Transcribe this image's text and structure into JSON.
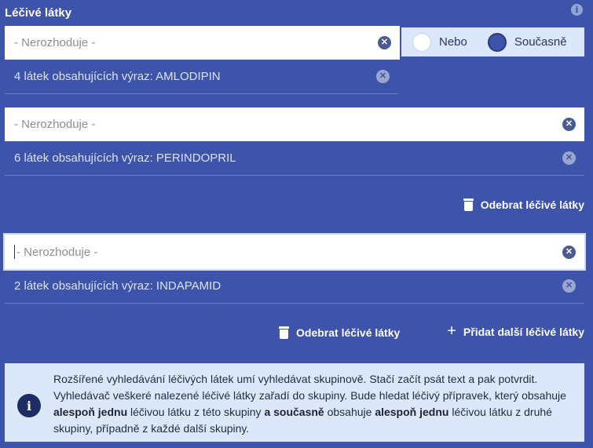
{
  "heading": "Léčivé látky",
  "groups": [
    {
      "placeholder": "- Nerozhoduje -",
      "result": "4 látek obsahujících výraz: AMLODIPIN"
    },
    {
      "placeholder": "- Nerozhoduje -",
      "result": "6 látek obsahujících výraz: PERINDOPRIL",
      "remove_label": "Odebrat léčivé látky"
    },
    {
      "placeholder": "- Nerozhoduje -",
      "result": "2 látek obsahujících výraz: INDAPAMID",
      "remove_label": "Odebrat léčivé látky"
    }
  ],
  "mode_toggle": {
    "options": [
      {
        "label": "Nebo",
        "selected": false
      },
      {
        "label": "Současně",
        "selected": true
      }
    ]
  },
  "add_label": "Přidat další léčivé látky",
  "clear_glyph": "✕",
  "info_glyph": "i",
  "icons": {
    "clear": "close-circle-icon",
    "info": "info-icon",
    "remove": "trash-icon",
    "add": "plus-icon"
  },
  "info": {
    "p1": "Rozšířené vyhledávání léčivých látek umí vyhledávat skupinově. Stačí začít psát text a pak potvrdit. Vyhledávač veškeré nalezené léčivé látky zařadí do skupiny. Bude hledat léčivý přípravek, který obsahuje ",
    "b1": "alespoň jednu",
    "p2": " léčivou látku z této skupiny ",
    "b2": "a současně",
    "p3": " obsahuje ",
    "b3": "alespoň jednu",
    "p4": " léčivou látku z druhé skupiny, případně z každé další skupiny."
  },
  "colors": {
    "background": "#3d54aa",
    "toggle_bg": "#dde7fb",
    "info_bg": "#dce8fa",
    "accent_dark": "#1b2d63"
  }
}
